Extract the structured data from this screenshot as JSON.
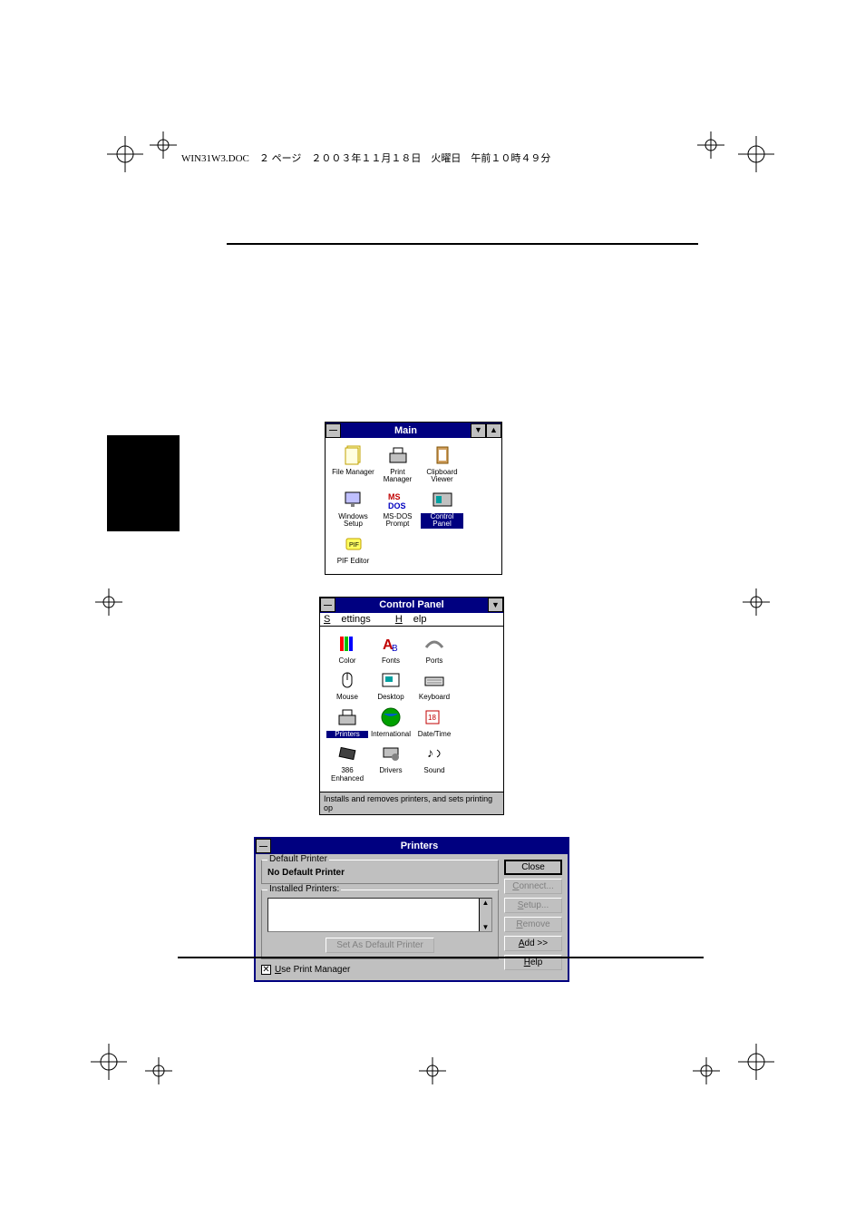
{
  "page_header": "WIN31W3.DOC　２ ページ　２００３年１１月１８日　火曜日　午前１０時４９分",
  "main_window": {
    "title": "Main",
    "icons": [
      {
        "label": "File Manager",
        "icon": "file-manager-icon",
        "selected": false
      },
      {
        "label": "Print Manager",
        "icon": "print-manager-icon",
        "selected": false
      },
      {
        "label": "Clipboard Viewer",
        "icon": "clipboard-viewer-icon",
        "selected": false
      },
      {
        "label": "Windows Setup",
        "icon": "windows-setup-icon",
        "selected": false
      },
      {
        "label": "MS-DOS Prompt",
        "icon": "msdos-prompt-icon",
        "selected": false
      },
      {
        "label": "Control Panel",
        "icon": "control-panel-icon",
        "selected": true
      },
      {
        "label": "PIF Editor",
        "icon": "pif-editor-icon",
        "selected": false
      }
    ]
  },
  "control_panel": {
    "title": "Control Panel",
    "menu": {
      "settings": "Settings",
      "help": "Help"
    },
    "icons": [
      {
        "label": "Color",
        "icon": "color-icon",
        "selected": false
      },
      {
        "label": "Fonts",
        "icon": "fonts-icon",
        "selected": false
      },
      {
        "label": "Ports",
        "icon": "ports-icon",
        "selected": false
      },
      {
        "label": "Mouse",
        "icon": "mouse-icon",
        "selected": false
      },
      {
        "label": "Desktop",
        "icon": "desktop-icon",
        "selected": false
      },
      {
        "label": "Keyboard",
        "icon": "keyboard-icon",
        "selected": false
      },
      {
        "label": "Printers",
        "icon": "printers-icon",
        "selected": true
      },
      {
        "label": "International",
        "icon": "international-icon",
        "selected": false
      },
      {
        "label": "Date/Time",
        "icon": "datetime-icon",
        "selected": false
      },
      {
        "label": "386 Enhanced",
        "icon": "386-enhanced-icon",
        "selected": false
      },
      {
        "label": "Drivers",
        "icon": "drivers-icon",
        "selected": false
      },
      {
        "label": "Sound",
        "icon": "sound-icon",
        "selected": false
      }
    ],
    "status": "Installs and removes printers, and sets printing op"
  },
  "printers_dialog": {
    "title": "Printers",
    "default_printer_legend": "Default Printer",
    "default_printer_value": "No Default Printer",
    "installed_printers_legend": "Installed Printers:",
    "set_default_btn": "Set As Default Printer",
    "use_print_manager": "Use Print Manager",
    "use_print_manager_checked": true,
    "buttons": {
      "close": "Close",
      "connect": "Connect...",
      "setup": "Setup...",
      "remove": "Remove",
      "add": "Add >>",
      "help": "Help"
    }
  }
}
